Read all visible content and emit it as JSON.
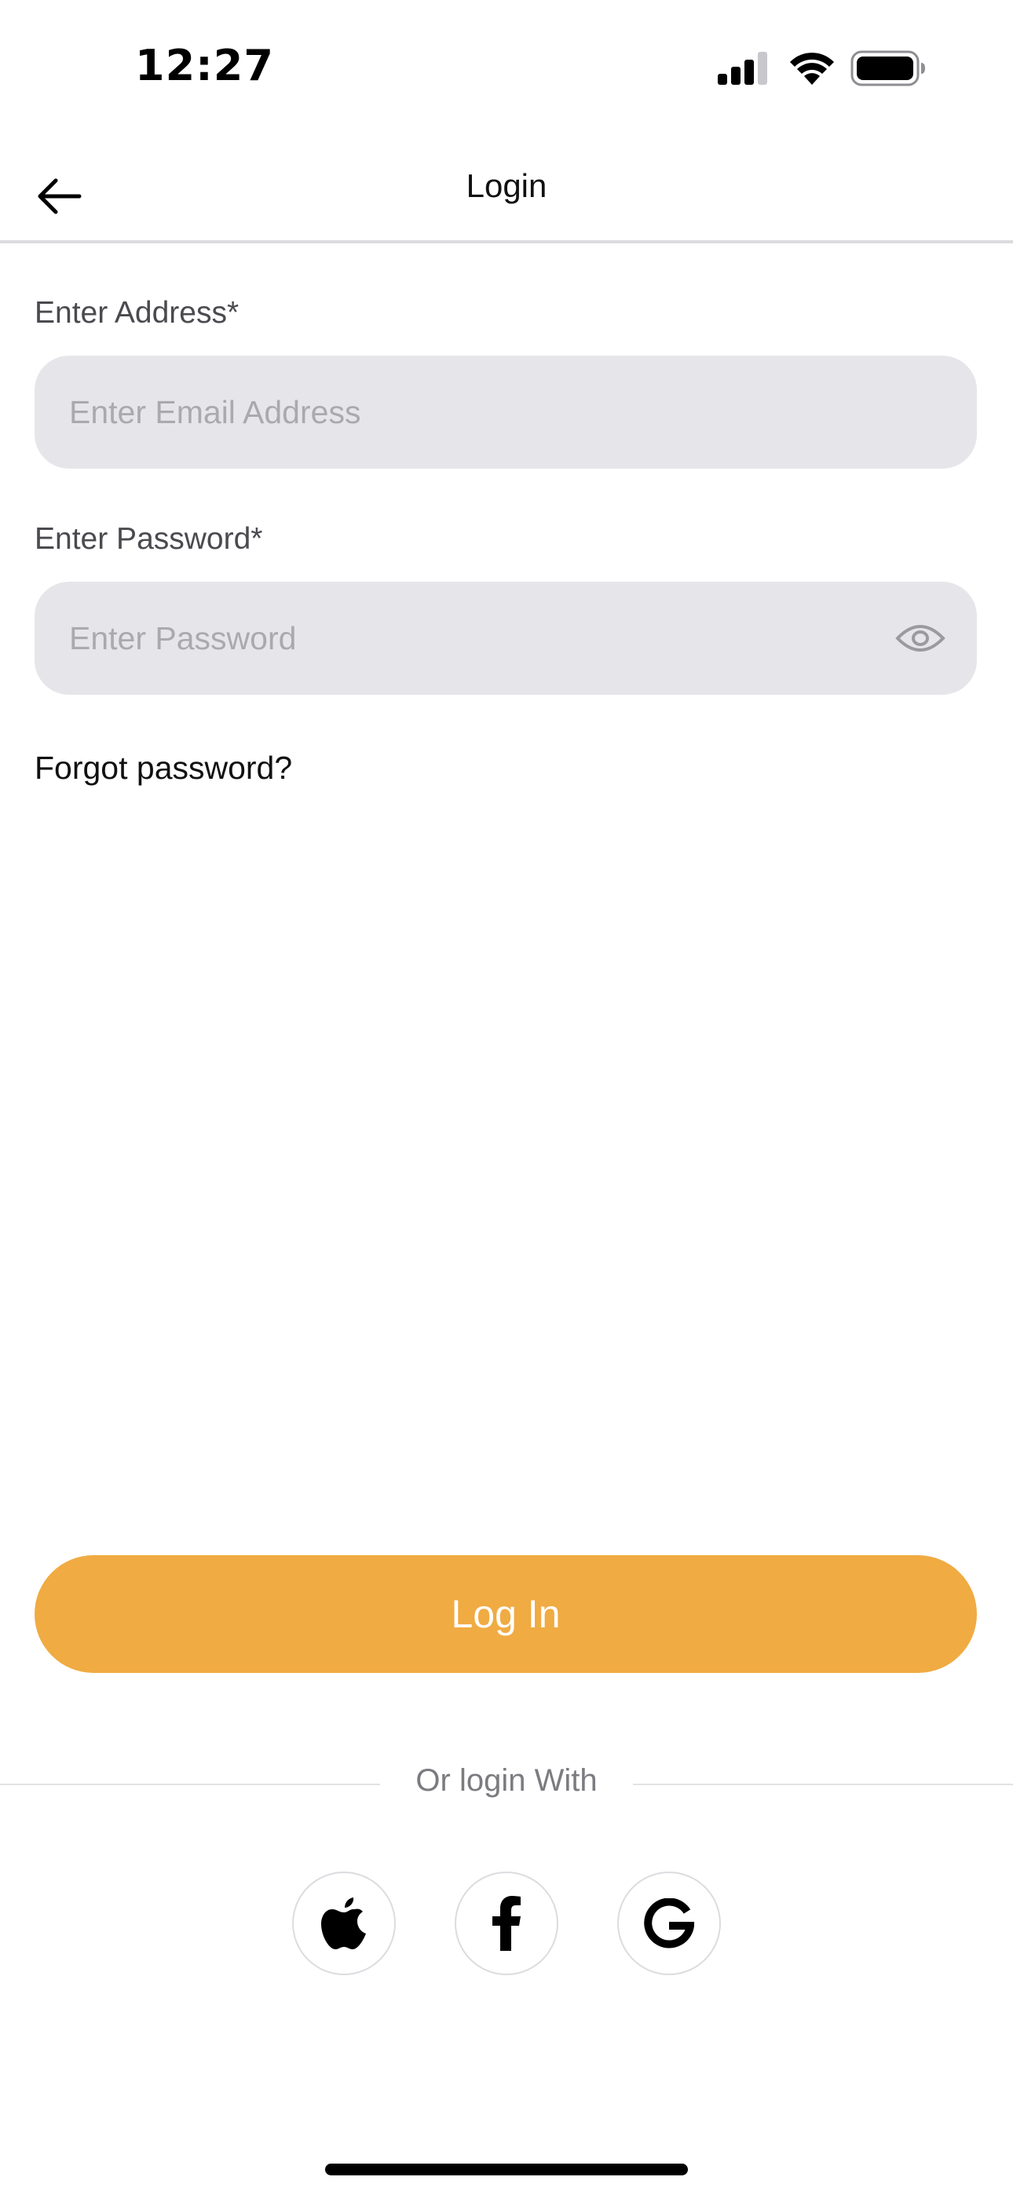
{
  "status_bar": {
    "time": "12:27",
    "signal_icon": "cellular-signal-icon",
    "wifi_icon": "wifi-icon",
    "battery_icon": "battery-icon"
  },
  "header": {
    "title": "Login",
    "back_icon": "arrow-left-icon"
  },
  "form": {
    "email": {
      "label": "Enter Address*",
      "placeholder": "Enter Email Address",
      "value": ""
    },
    "password": {
      "label": "Enter Password*",
      "placeholder": "Enter Password",
      "value": "",
      "toggle_icon": "eye-icon"
    },
    "forgot_password": "Forgot password?"
  },
  "actions": {
    "login_label": "Log In",
    "divider_text": "Or login With",
    "social": [
      {
        "name": "Apple",
        "icon": "apple-icon"
      },
      {
        "name": "Facebook",
        "icon": "facebook-icon"
      },
      {
        "name": "Google",
        "icon": "google-icon"
      }
    ]
  },
  "colors": {
    "accent": "#F0AB42",
    "input_background": "#E6E6EA",
    "placeholder": "#A9A9B0",
    "label": "#4A4A4F",
    "divider": "#E2E2E6"
  }
}
